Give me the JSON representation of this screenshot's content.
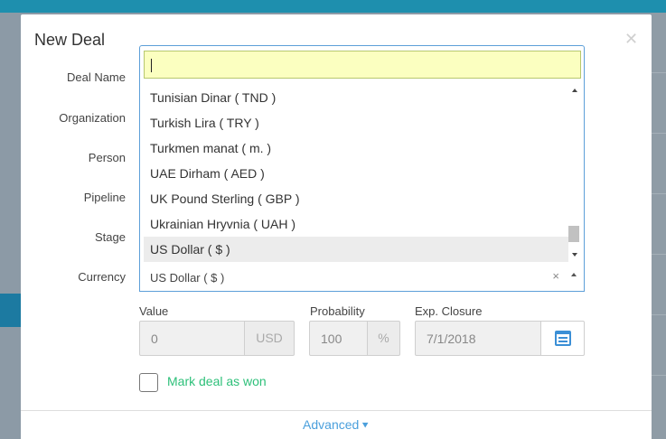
{
  "modal": {
    "title": "New Deal",
    "labels": {
      "deal_name": "Deal Name",
      "organization": "Organization",
      "person": "Person",
      "pipeline": "Pipeline",
      "stage": "Stage",
      "currency": "Currency"
    }
  },
  "currency_dropdown": {
    "search_value": "",
    "options": [
      "Tunisian Dinar ( TND )",
      "Turkish Lira ( TRY )",
      "Turkmen manat ( m. )",
      "UAE Dirham ( AED )",
      "UK Pound Sterling ( GBP )",
      "Ukrainian Hryvnia ( UAH )",
      "US Dollar ( $ )"
    ],
    "highlighted_option": "US Dollar ( $ )"
  },
  "currency_select": {
    "value": "US Dollar ( $ )",
    "clear_glyph": "×"
  },
  "value_field": {
    "label": "Value",
    "value": "0",
    "addon": "USD"
  },
  "probability_field": {
    "label": "Probability",
    "value": "100",
    "addon": "%"
  },
  "closure_field": {
    "label": "Exp. Closure",
    "value": "7/1/2018"
  },
  "won_checkbox": {
    "label": "Mark deal as won",
    "checked": false
  },
  "advanced": {
    "label": "Advanced",
    "chevron": "»"
  },
  "icons": {
    "close": "close-icon",
    "calendar": "calendar-icon"
  },
  "colors": {
    "accent": "#4a9fdc",
    "won": "#2ec07a",
    "search_bg": "#fbffc0",
    "topbar": "#1e8fae"
  }
}
